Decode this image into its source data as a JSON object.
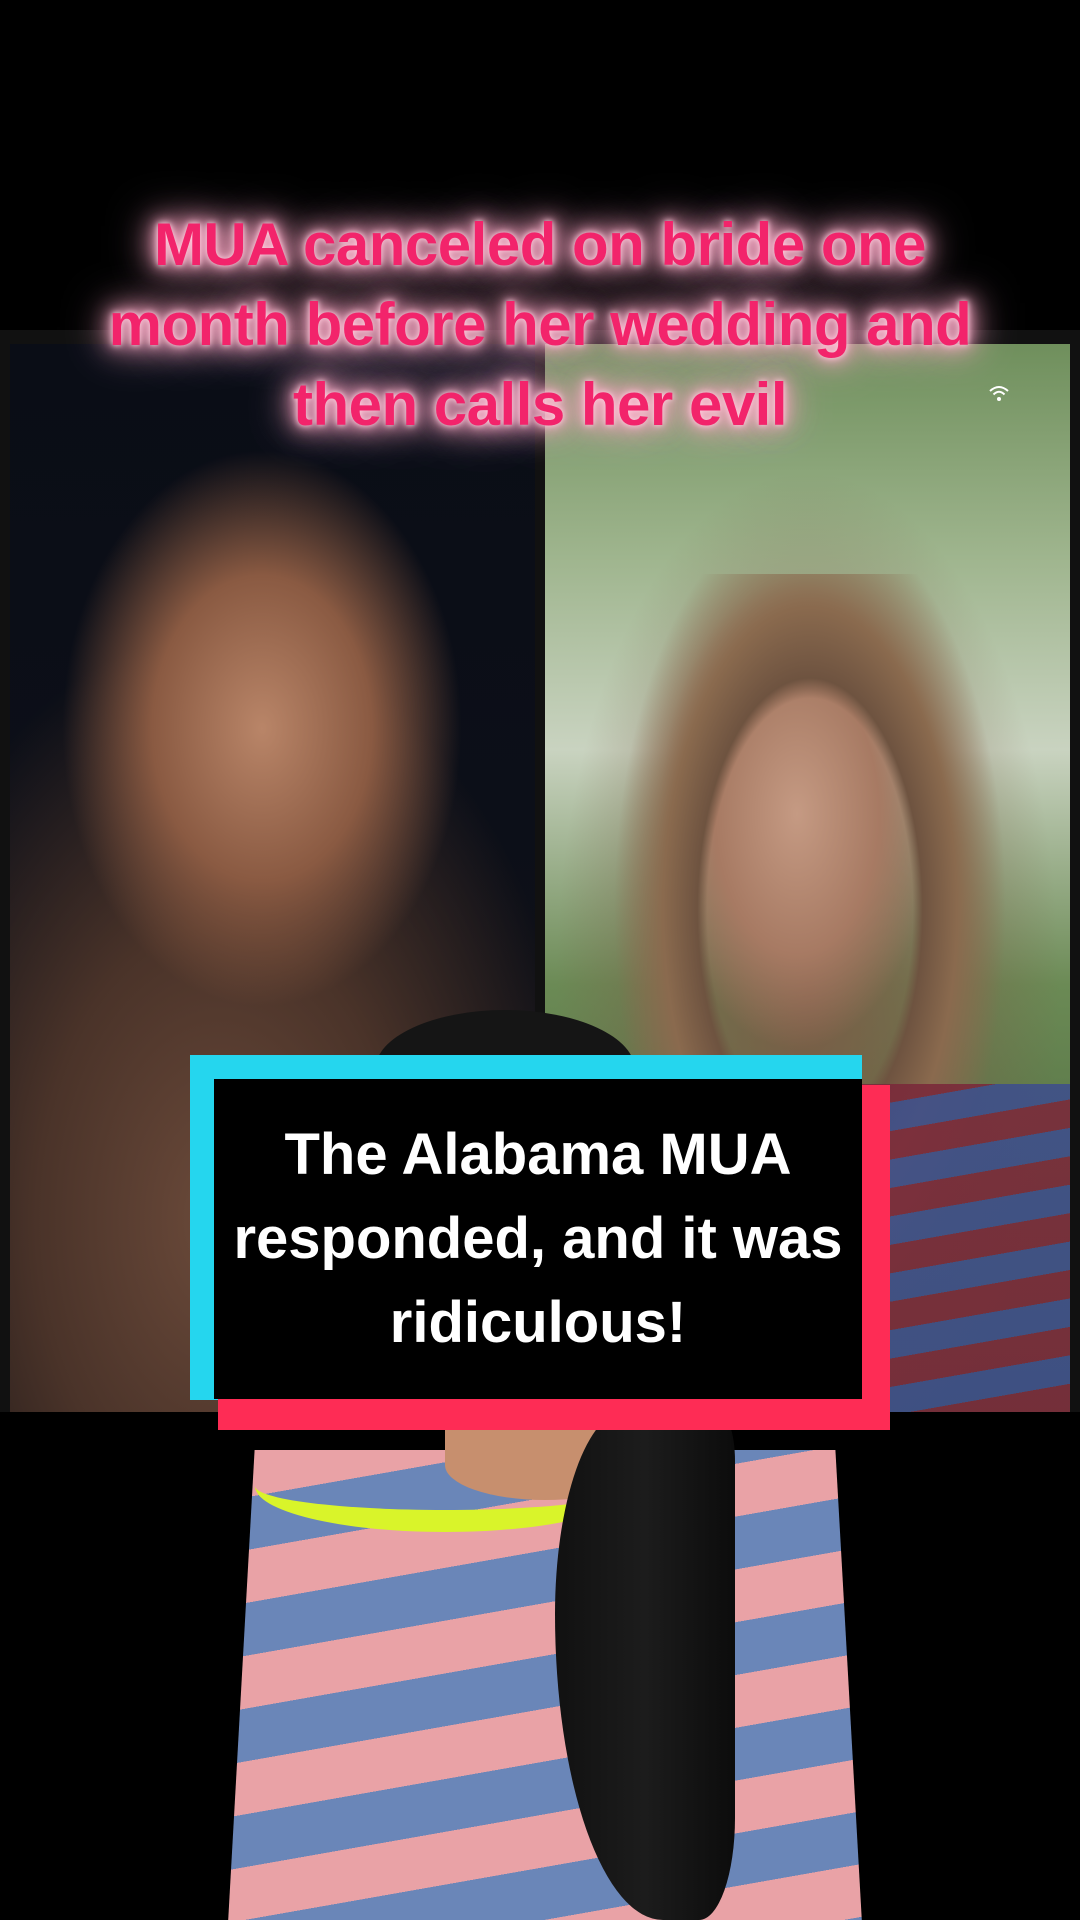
{
  "video": {
    "top_caption": "MUA canceled on bride one month before her wedding and then calls her evil",
    "box_caption": "The Alabama MUA responded, and it was ridiculous!",
    "colors": {
      "top_caption": "#f2246b",
      "box_fill": "#000000",
      "box_accent_cyan": "#25d6ee",
      "box_accent_red": "#fe2c55",
      "background": "#000000"
    },
    "icons": {
      "status": "wifi-icon"
    }
  }
}
